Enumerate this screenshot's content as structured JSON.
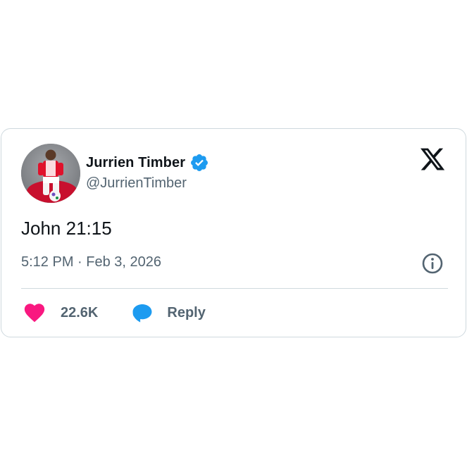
{
  "author": {
    "display_name": "Jurrien Timber",
    "handle": "@JurrienTimber",
    "verified": true,
    "avatar_description": "player-photo"
  },
  "tweet": {
    "text": "John 21:15",
    "timestamp": "5:12 PM · Feb 3, 2026"
  },
  "actions": {
    "likes_count": "22.6K",
    "reply_label": "Reply"
  },
  "icons": {
    "brand": "x-logo-icon",
    "info": "info-icon",
    "like": "heart-icon",
    "reply": "speech-bubble-icon",
    "verified": "verified-badge-icon"
  },
  "colors": {
    "verified_blue": "#1d9bf0",
    "heart_pink": "#f91880",
    "text_primary": "#0f1419",
    "text_secondary": "#536471",
    "border": "#cfd9de"
  }
}
